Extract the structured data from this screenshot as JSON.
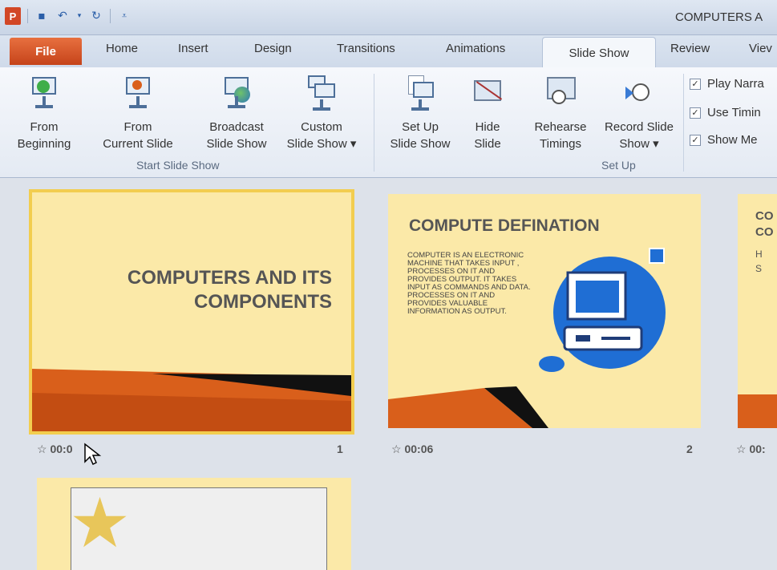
{
  "app": {
    "logo": "P",
    "title": "COMPUTERS A"
  },
  "quick_access": {
    "items": [
      "save-icon",
      "undo-icon",
      "dropdown-icon",
      "redo-icon",
      "customize-icon"
    ]
  },
  "tabs": {
    "file": "File",
    "home": "Home",
    "insert": "Insert",
    "design": "Design",
    "transitions": "Transitions",
    "animations": "Animations",
    "slide_show": "Slide Show",
    "review": "Review",
    "view": "Viev"
  },
  "ribbon": {
    "start_group": {
      "label": "Start Slide Show",
      "from_beginning": [
        "From",
        "Beginning"
      ],
      "from_current": [
        "From",
        "Current Slide"
      ],
      "broadcast": [
        "Broadcast",
        "Slide Show"
      ],
      "custom": [
        "Custom",
        "Slide Show ▾"
      ]
    },
    "setup_group": {
      "label": "Set Up",
      "setup": [
        "Set Up",
        "Slide Show"
      ],
      "hide": [
        "Hide",
        "Slide"
      ],
      "rehearse": [
        "Rehearse",
        "Timings"
      ],
      "record": [
        "Record Slide",
        "Show ▾"
      ]
    },
    "checks": {
      "play_narrations": "Play Narra",
      "use_timings": "Use Timin",
      "show_media": "Show Me"
    },
    "check_mark": "✓"
  },
  "slides": [
    {
      "number": "1",
      "time": "00:0",
      "title_line1": "COMPUTERS AND ITS",
      "title_line2": "COMPONENTS"
    },
    {
      "number": "2",
      "time": "00:06",
      "title": "COMPUTE DEFINATION",
      "body": "COMPUTER IS AN ELECTRONIC MACHINE THAT TAKES INPUT , PROCESSES ON IT AND PROVIDES OUTPUT. IT TAKES INPUT AS COMMANDS AND DATA. PROCESSES ON IT AND PROVIDES VALUABLE INFORMATION AS OUTPUT."
    },
    {
      "time": "00:",
      "title_line1": "CO",
      "title_line2": "CO",
      "bullet1": "H",
      "bullet2": "S"
    }
  ],
  "colors": {
    "slide_bg": "#fbe9a8",
    "accent_orange": "#d95f1b",
    "selection": "#f2cd4f",
    "file_tab": "#d24726"
  }
}
